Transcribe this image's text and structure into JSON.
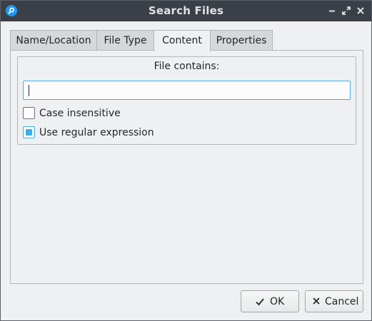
{
  "window": {
    "title": "Search Files"
  },
  "tabs": [
    {
      "label": "Name/Location"
    },
    {
      "label": "File Type"
    },
    {
      "label": "Content"
    },
    {
      "label": "Properties"
    }
  ],
  "active_tab": "Content",
  "content": {
    "group_title": "File contains:",
    "search_value": "",
    "options": [
      {
        "label": "Case insensitive",
        "checked": false
      },
      {
        "label": "Use regular expression",
        "checked": true
      }
    ]
  },
  "buttons": {
    "ok": "OK",
    "cancel": "Cancel"
  },
  "icons": {
    "app": "search-icon",
    "minimize": "minimize-icon",
    "maximize": "maximize-icon",
    "close": "close-icon",
    "ok": "checkmark-icon",
    "cancel": "close-icon"
  },
  "colors": {
    "accent": "#3daee9",
    "titlebar": "#3b4048",
    "background": "#eff0f1"
  }
}
